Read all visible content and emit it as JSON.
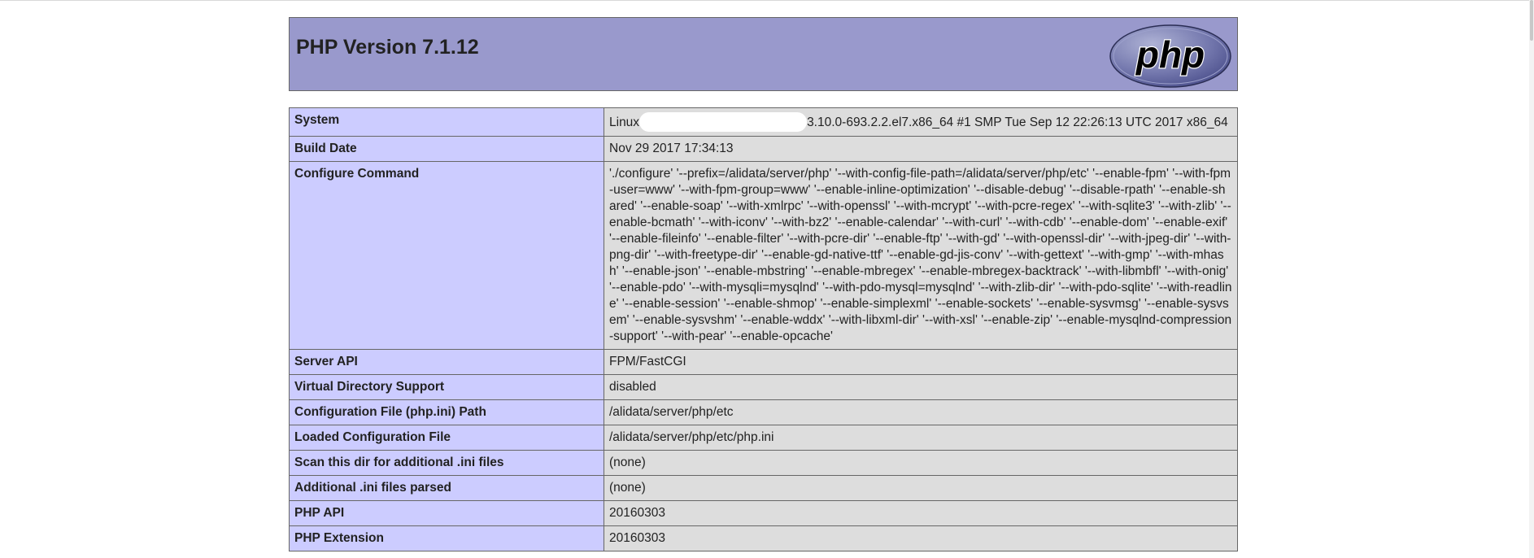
{
  "header": {
    "title": "PHP Version 7.1.12",
    "logo_text": "php"
  },
  "colors": {
    "header_bg": "#9999cc",
    "key_cell_bg": "#ccccff",
    "value_cell_bg": "#dddddd",
    "border": "#666666"
  },
  "rows": [
    {
      "key": "System",
      "value_prefix": "Linux",
      "value_redacted": true,
      "value": "3.10.0-693.2.2.el7.x86_64 #1 SMP Tue Sep 12 22:26:13 UTC 2017 x86_64"
    },
    {
      "key": "Build Date",
      "value": "Nov 29 2017 17:34:13"
    },
    {
      "key": "Configure Command",
      "value": "'./configure' '--prefix=/alidata/server/php' '--with-config-file-path=/alidata/server/php/etc' '--enable-fpm' '--with-fpm-user=www' '--with-fpm-group=www' '--enable-inline-optimization' '--disable-debug' '--disable-rpath' '--enable-shared' '--enable-soap' '--with-xmlrpc' '--with-openssl' '--with-mcrypt' '--with-pcre-regex' '--with-sqlite3' '--with-zlib' '--enable-bcmath' '--with-iconv' '--with-bz2' '--enable-calendar' '--with-curl' '--with-cdb' '--enable-dom' '--enable-exif' '--enable-fileinfo' '--enable-filter' '--with-pcre-dir' '--enable-ftp' '--with-gd' '--with-openssl-dir' '--with-jpeg-dir' '--with-png-dir' '--with-freetype-dir' '--enable-gd-native-ttf' '--enable-gd-jis-conv' '--with-gettext' '--with-gmp' '--with-mhash' '--enable-json' '--enable-mbstring' '--enable-mbregex' '--enable-mbregex-backtrack' '--with-libmbfl' '--with-onig' '--enable-pdo' '--with-mysqli=mysqlnd' '--with-pdo-mysql=mysqlnd' '--with-zlib-dir' '--with-pdo-sqlite' '--with-readline' '--enable-session' '--enable-shmop' '--enable-simplexml' '--enable-sockets' '--enable-sysvmsg' '--enable-sysvsem' '--enable-sysvshm' '--enable-wddx' '--with-libxml-dir' '--with-xsl' '--enable-zip' '--enable-mysqlnd-compression-support' '--with-pear' '--enable-opcache'"
    },
    {
      "key": "Server API",
      "value": "FPM/FastCGI"
    },
    {
      "key": "Virtual Directory Support",
      "value": "disabled"
    },
    {
      "key": "Configuration File (php.ini) Path",
      "value": "/alidata/server/php/etc"
    },
    {
      "key": "Loaded Configuration File",
      "value": "/alidata/server/php/etc/php.ini"
    },
    {
      "key": "Scan this dir for additional .ini files",
      "value": "(none)"
    },
    {
      "key": "Additional .ini files parsed",
      "value": "(none)"
    },
    {
      "key": "PHP API",
      "value": "20160303"
    },
    {
      "key": "PHP Extension",
      "value": "20160303"
    }
  ]
}
